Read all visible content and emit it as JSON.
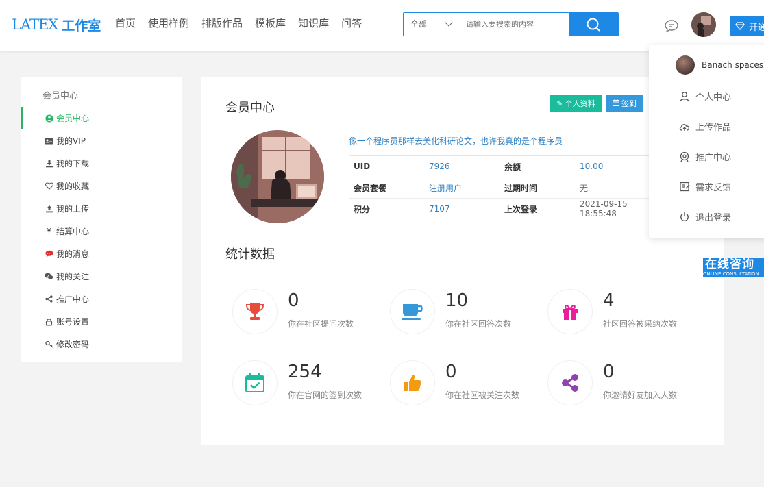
{
  "header": {
    "logo_latex": "LATEX",
    "logo_studio": "工作室",
    "nav": [
      "首页",
      "使用样例",
      "排版作品",
      "模板库",
      "知识库",
      "问答"
    ],
    "search_scope": "全部",
    "search_placeholder": "请输入要搜索的内容",
    "open_label": "开通"
  },
  "sidebar": {
    "title": "会员中心",
    "items": [
      {
        "label": "会员中心",
        "icon": "user-circle-icon",
        "active": true
      },
      {
        "label": "我的VIP",
        "icon": "id-card-icon"
      },
      {
        "label": "我的下载",
        "icon": "download-icon"
      },
      {
        "label": "我的收藏",
        "icon": "heart-icon"
      },
      {
        "label": "我的上传",
        "icon": "upload-icon"
      },
      {
        "label": "结算中心",
        "icon": "yen-icon"
      },
      {
        "label": "我的消息",
        "icon": "chat-bubble-icon"
      },
      {
        "label": "我的关注",
        "icon": "wechat-icon"
      },
      {
        "label": "推广中心",
        "icon": "share-icon"
      },
      {
        "label": "账号设置",
        "icon": "lock-icon"
      },
      {
        "label": "修改密码",
        "icon": "key-icon"
      }
    ]
  },
  "main": {
    "heading": "会员中心",
    "profile_button": "个人资料",
    "sign_button": "签到",
    "motto": "像一个程序员那样去美化科研论文，也许我真的是个程序员",
    "info": [
      {
        "k1": "UID",
        "v1": "7926",
        "k2": "余额",
        "v2": "10.00"
      },
      {
        "k1": "会员套餐",
        "v1": "注册用户",
        "k2": "过期时间",
        "v2": "无"
      },
      {
        "k1": "积分",
        "v1": "7107",
        "k2": "上次登录",
        "v2": "2021-09-15 18:55:48"
      }
    ],
    "stats_title": "统计数据",
    "stats": [
      {
        "num": "0",
        "label": "你在社区提问次数",
        "icon": "trophy-icon",
        "color": "#e74c3c"
      },
      {
        "num": "10",
        "label": "你在社区回答次数",
        "icon": "coffee-cup-icon",
        "color": "#3498db"
      },
      {
        "num": "4",
        "label": "社区回答被采纳次数",
        "icon": "gift-icon",
        "color": "#e91e9c"
      },
      {
        "num": "254",
        "label": "你在官网的签到次数",
        "icon": "calendar-check-icon",
        "color": "#1abc9c"
      },
      {
        "num": "0",
        "label": "你在社区被关注次数",
        "icon": "thumbs-up-icon",
        "color": "#f39c12"
      },
      {
        "num": "0",
        "label": "你邀请好友加入人数",
        "icon": "share-nodes-icon",
        "color": "#8e44ad"
      }
    ]
  },
  "dropdown": {
    "username": "Banach spaces",
    "items": [
      {
        "label": "个人中心",
        "icon": "person-icon"
      },
      {
        "label": "上传作品",
        "icon": "cloud-upload-icon"
      },
      {
        "label": "推广中心",
        "icon": "promote-icon"
      },
      {
        "label": "需求反馈",
        "icon": "feedback-icon"
      },
      {
        "label": "退出登录",
        "icon": "power-icon"
      }
    ]
  },
  "consult": {
    "title": "在线咨询",
    "subtitle": "ONLINE CONSULTATION"
  }
}
